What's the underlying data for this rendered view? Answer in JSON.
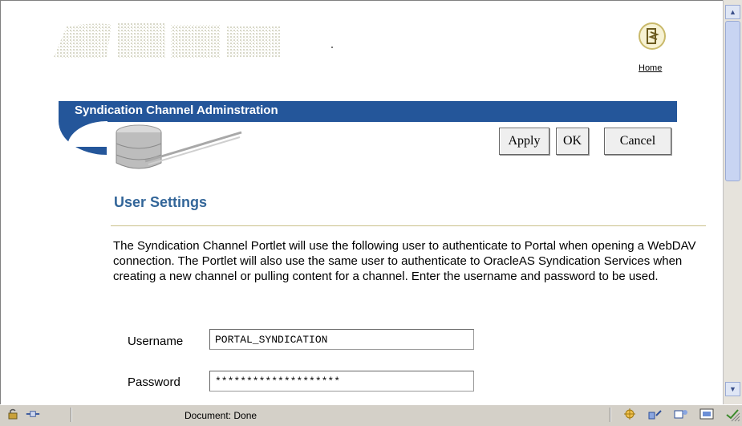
{
  "header": {
    "home_label": "Home",
    "banner_title": "Syndication Channel Adminstration"
  },
  "toolbar": {
    "apply_label": "Apply",
    "ok_label": "OK",
    "cancel_label": "Cancel"
  },
  "section": {
    "title": "User Settings",
    "description": "The Syndication Channel Portlet will use the following user to authenticate to Portal when opening a WebDAV connection. The Portlet will also use the same user to authenticate to OracleAS Syndication Services when creating a new channel or pulling content for a channel. Enter the username and password to be used."
  },
  "form": {
    "username_label": "Username",
    "username_value": "PORTAL_SYNDICATION",
    "password_label": "Password",
    "password_value": "********************"
  },
  "statusbar": {
    "text": "Document: Done"
  },
  "colors": {
    "banner": "#24569a",
    "section_title": "#336699",
    "rule": "#c9c08a"
  },
  "icons": [
    "home-icon",
    "database-icon",
    "lock-icon",
    "connection-icon",
    "scroll-up-icon",
    "scroll-down-icon",
    "status-icons"
  ]
}
